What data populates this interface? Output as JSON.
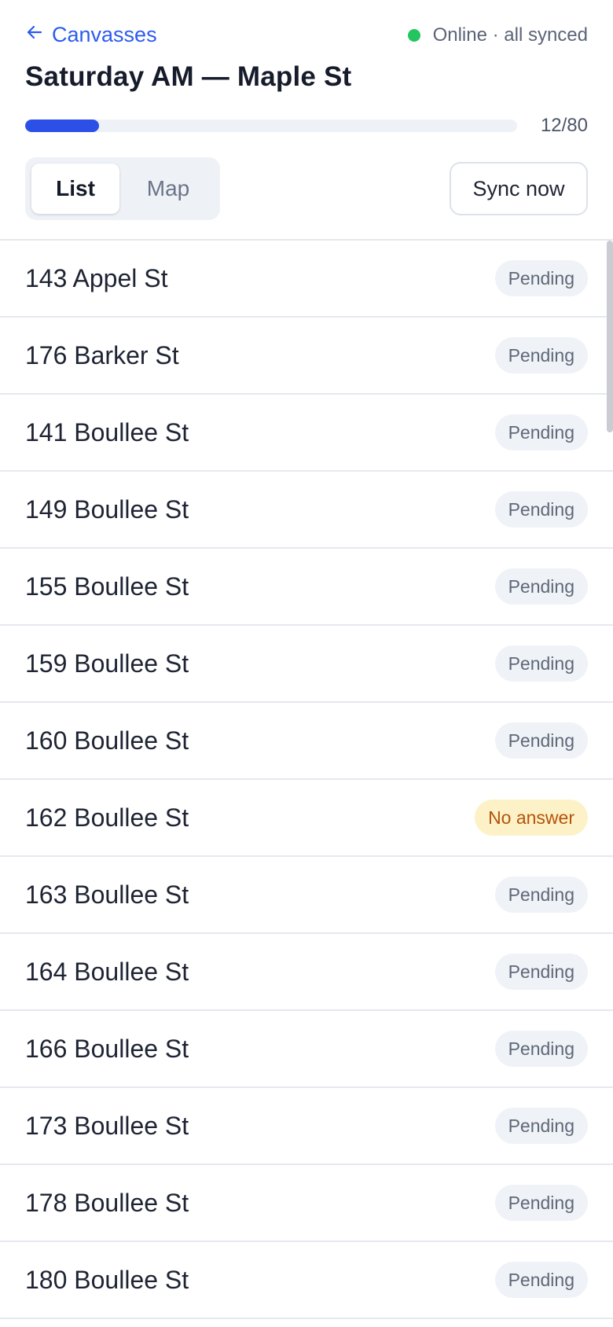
{
  "header": {
    "back_label": "Canvasses",
    "status_text": "Online · all synced",
    "title": "Saturday AM — Maple St",
    "progress": {
      "done": 12,
      "total": 80,
      "label": "12/80"
    },
    "tabs": [
      {
        "label": "List",
        "active": true
      },
      {
        "label": "Map",
        "active": false
      }
    ],
    "sync_label": "Sync now"
  },
  "colors": {
    "accent": "#2c4fe8",
    "link": "#2c5bf0",
    "online": "#22c55e",
    "pending_badge_bg": "#eff2f6",
    "no_answer_badge_bg": "#fdf2c7",
    "no_answer_text": "#b4530a"
  },
  "icons": {
    "back": "arrow-left-icon",
    "status": "online-dot-icon"
  },
  "houses": [
    {
      "address": "143 Appel St",
      "status": "Pending"
    },
    {
      "address": "176 Barker St",
      "status": "Pending"
    },
    {
      "address": "141 Boullee St",
      "status": "Pending"
    },
    {
      "address": "149 Boullee St",
      "status": "Pending"
    },
    {
      "address": "155 Boullee St",
      "status": "Pending"
    },
    {
      "address": "159 Boullee St",
      "status": "Pending"
    },
    {
      "address": "160 Boullee St",
      "status": "Pending"
    },
    {
      "address": "162 Boullee St",
      "status": "No answer"
    },
    {
      "address": "163 Boullee St",
      "status": "Pending"
    },
    {
      "address": "164 Boullee St",
      "status": "Pending"
    },
    {
      "address": "166 Boullee St",
      "status": "Pending"
    },
    {
      "address": "173 Boullee St",
      "status": "Pending"
    },
    {
      "address": "178 Boullee St",
      "status": "Pending"
    },
    {
      "address": "180 Boullee St",
      "status": "Pending"
    }
  ]
}
